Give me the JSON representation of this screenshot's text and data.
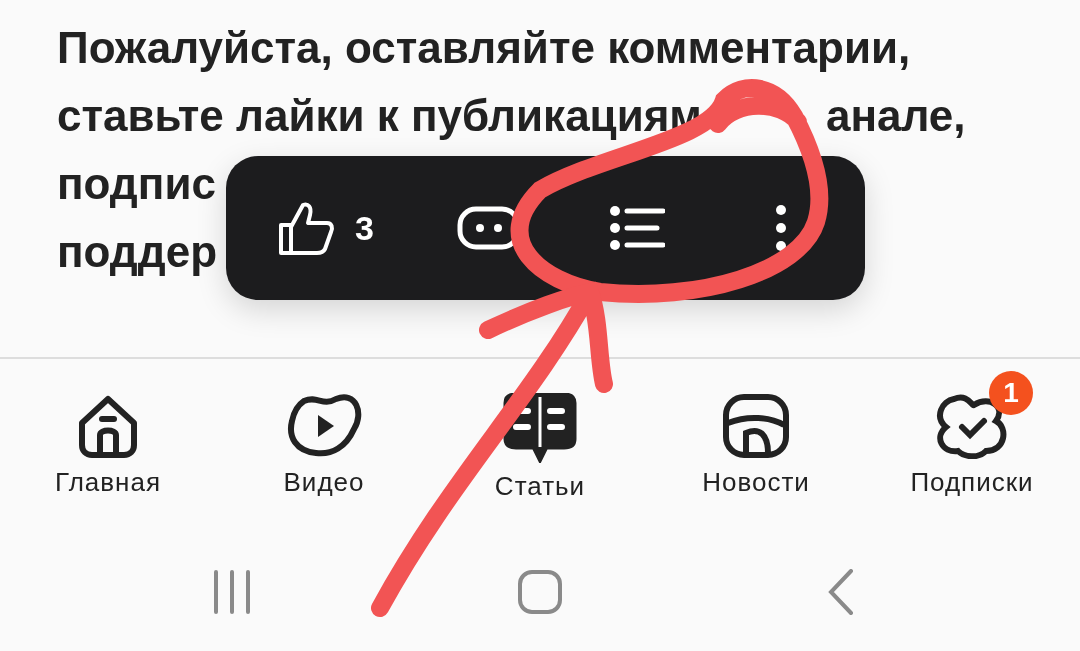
{
  "article": {
    "lines": [
      "Пожалуйста, оставляйте комментарии,",
      [
        "ставьте лайки к публикациям",
        "анале,"
      ],
      "подпис",
      "поддер"
    ]
  },
  "toolbar": {
    "like_count": "3"
  },
  "bottom_nav": [
    {
      "kind": "home",
      "label": "Главная",
      "selected": false
    },
    {
      "kind": "video",
      "label": "Видео",
      "selected": false
    },
    {
      "kind": "articles",
      "label": "Статьи",
      "selected": true
    },
    {
      "kind": "news",
      "label": "Новости",
      "selected": false
    },
    {
      "kind": "subscriptions",
      "label": "Подписки",
      "selected": false,
      "badge": "1"
    }
  ]
}
